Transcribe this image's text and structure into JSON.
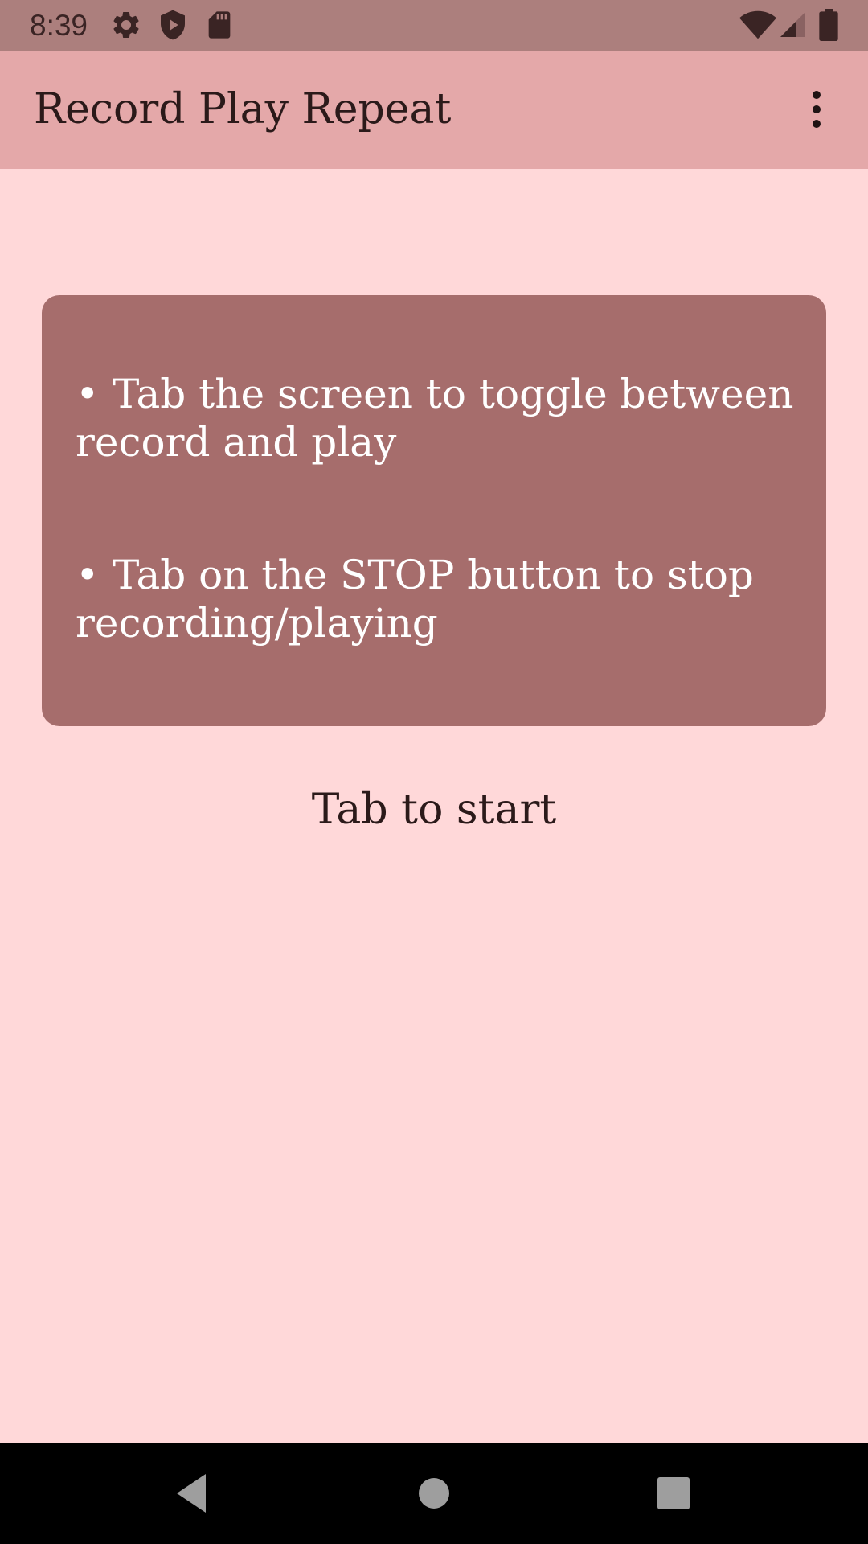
{
  "status_bar": {
    "time": "8:39",
    "left_icons": [
      "gear-icon",
      "shield-icon",
      "sd-card-icon"
    ],
    "right_icons": [
      "wifi-icon",
      "cell-signal-icon",
      "battery-icon"
    ]
  },
  "app_bar": {
    "title": "Record Play Repeat",
    "overflow_icon": "more-vert-icon"
  },
  "instructions": {
    "items": [
      "Tab the screen to toggle between record and play",
      "Tab on the STOP button to stop recording/playing"
    ],
    "bullet": "•"
  },
  "start_label": "Tab to start",
  "nav_bar": {
    "buttons": [
      "back-icon",
      "home-icon",
      "recents-icon"
    ]
  },
  "colors": {
    "status_bar": "#AC7F7D",
    "app_bar": "#E4A8A9",
    "background": "#FFD8D9",
    "card": "#A66D6C",
    "nav_bar": "#000000"
  }
}
